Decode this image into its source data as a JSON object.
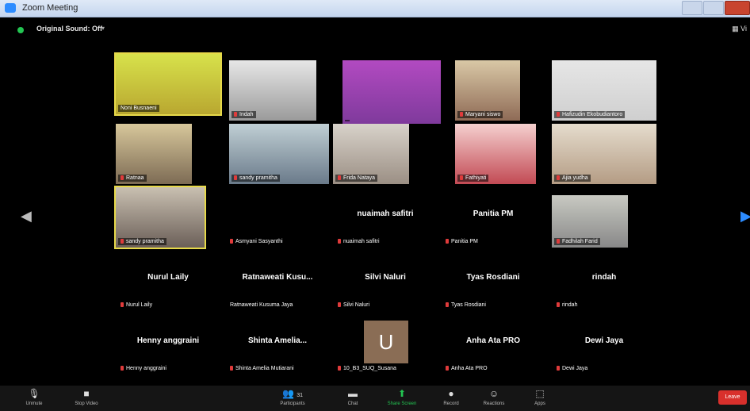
{
  "window": {
    "title": "Zoom Meeting"
  },
  "topbar": {
    "sound_label": "Original Sound: Off",
    "view_label": "Vi"
  },
  "gallery": {
    "video_tiles": [
      {
        "name": "Noni Busnaeni"
      },
      {
        "name": "Indah"
      },
      {
        "name": ""
      },
      {
        "name": "Maryani siswo"
      },
      {
        "name": "Hafizudin Ekobudiantoro"
      },
      {
        "name": "Ratnaa"
      },
      {
        "name": "sandy pramitha"
      },
      {
        "name": "Frida Nataya"
      },
      {
        "name": "Fathiyati"
      },
      {
        "name": "Ajia yudha"
      },
      {
        "name": "sandy pramitha"
      },
      {
        "name": "Fadhilah Farid"
      }
    ],
    "name_tiles": [
      {
        "display": "",
        "tag": "Asmyani Sasyanthi"
      },
      {
        "display": "nuaimah safitri",
        "tag": "nuaimah safitri"
      },
      {
        "display": "Panitia PM",
        "tag": "Panitia PM"
      },
      {
        "display": "Nurul Laily",
        "tag": "Nurul Laily"
      },
      {
        "display": "Ratnaweati Kusu...",
        "tag": "Ratnaweati Kusuma Jaya"
      },
      {
        "display": "Silvi Naluri",
        "tag": "Silvi Naluri"
      },
      {
        "display": "Tyas Rosdiani",
        "tag": "Tyas Rosdiani"
      },
      {
        "display": "rindah",
        "tag": "rindah"
      },
      {
        "display": "Henny anggraini",
        "tag": "Henny anggraini"
      },
      {
        "display": "Shinta Amelia...",
        "tag": "Shinta Amelia Mutiarani"
      },
      {
        "display": "",
        "tag": "10_B3_SUQ_Susana"
      },
      {
        "display": "Anha Ata PRO",
        "tag": "Anha Ata PRO"
      },
      {
        "display": "Dewi Jaya",
        "tag": "Dewi Jaya"
      }
    ],
    "avatar_letter": "U"
  },
  "toolbar": {
    "unmute": "Unmute",
    "stop_video": "Stop Video",
    "participants": "Participants",
    "participants_count": "31",
    "chat": "Chat",
    "share_screen": "Share Screen",
    "record": "Record",
    "reactions": "Reactions",
    "apps": "Apps",
    "leave": "Leave"
  },
  "colors": {
    "accent": "#2d8cff",
    "leave": "#d9302c",
    "active": "#23c552"
  }
}
